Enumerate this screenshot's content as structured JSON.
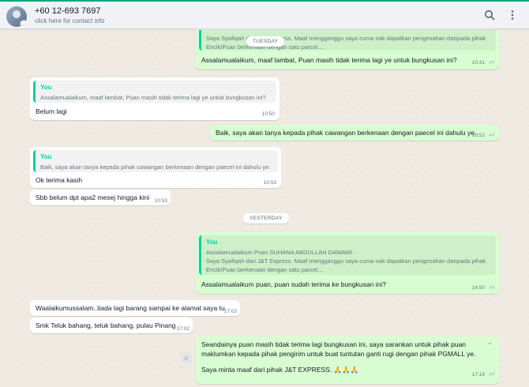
{
  "header": {
    "contact_name": "+60 12-693 7697",
    "contact_sub": "click here for contact info",
    "search_icon": "search-icon",
    "menu_icon": "more-vertical-icon",
    "accent": "#00a884"
  },
  "day_separators": {
    "tuesday": "TUESDAY",
    "yesterday": "YESTERDAY"
  },
  "messages": {
    "m1": {
      "quote_line1": "Saya Syafiqah dari J&T Express. Maaf mengganggu saya cuma nak dapatkan pengesahan daripada pihak",
      "quote_line2": "Encik/Puan berkenaan dengan satu parcel....",
      "text": "Assalamualaikum, maaf lambat, Puan masih tidak terima lagi ye untuk bungkusan ini?",
      "time": "10:31"
    },
    "m2": {
      "quote_author": "You",
      "quote_text": "Assalamualaikum, maaf lambat, Puan masih tidak terima lagi ye untuk bungkusan ini?",
      "text": "Belum lagi",
      "time": "10:50"
    },
    "m3": {
      "text": "Baik, saya akan tanya kepada pihak cawangan berkenaan dengan paecel ini dahulu ye.",
      "time": "10:52"
    },
    "m4": {
      "quote_author": "You",
      "quote_text": "Baik, saya akan tanya kepada pihak cawangan berkenaan dengan paecel ini dahulu ye.",
      "text": "Ok terima kasih",
      "time": "10:53"
    },
    "m5": {
      "text": "Sbb belum dpt apa2 mesej  hingga kini",
      "time": "10:53"
    },
    "m6": {
      "quote_author": "You",
      "quote_line1": "Assalamualaikum Puan SUHANA ABDULLAH DAWAWI .",
      "quote_line2": "Saya Syafiqah dari J&T Express. Maaf mengganggu saya cuma nak dapatkan pengesahan daripada pihak",
      "quote_line3": "Encik/Puan berkenaan dengan satu parcel....",
      "text": "Assalamualaikum puan, puan sudah terima ke bungkusan ini?",
      "time": "14:50"
    },
    "m7": {
      "text": "Waalaikumussalam..tiada lagi barang sampai ke alamat saya tu",
      "time": "17:02"
    },
    "m8": {
      "text": "Smk Teluk bahang, teluk bahang, pulau Pinang",
      "time": "17:02"
    },
    "m9": {
      "line1": "Seandainya puan masih tidak terima lagi bungkusan ini, saya sarankan untuk pihak puan",
      "line2": "maklumkan kepada pihak pengirim untuk buat tuntutan ganti rugi dengan pihak PGMALL ye.",
      "line3": "Saya minta maaf dari pihak J&T EXPRESS. 🙏🙏🙏",
      "time": "17:16"
    }
  },
  "colors": {
    "outgoing_bubble": "#d9fdd3",
    "incoming_bubble": "#ffffff",
    "quote_accent": "#06cf9c",
    "chat_background": "#efeae2"
  }
}
